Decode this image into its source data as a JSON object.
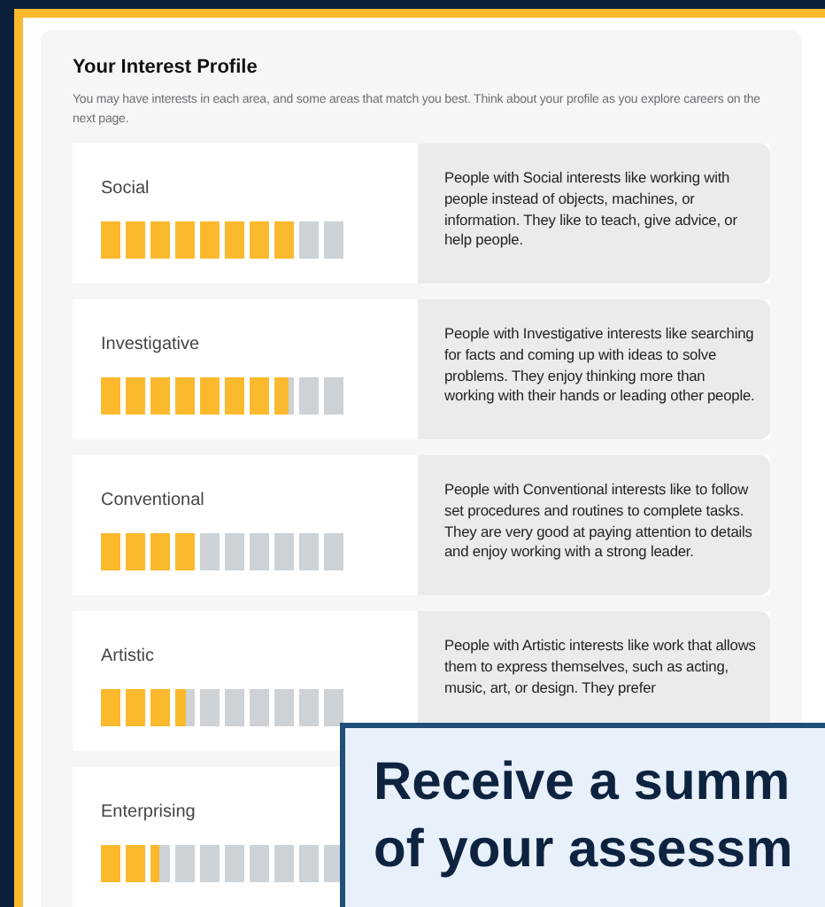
{
  "profile": {
    "title": "Your Interest Profile",
    "intro": "You may have interests in each area, and some areas that match you best. Think about your profile as you explore careers on the next page."
  },
  "areas": [
    {
      "name": "Social",
      "level": 0.8,
      "description": "People with Social interests like working with people instead of objects, machines, or information. They like to teach, give advice, or help people."
    },
    {
      "name": "Investigative",
      "level": 0.775,
      "description": "People with Investigative interests like searching for facts and coming up with ideas to solve problems. They enjoy thinking more than working with their hands or leading other people."
    },
    {
      "name": "Conventional",
      "level": 0.4,
      "description": "People with Conventional interests like to follow set procedures and routines to complete tasks. They are very good at paying attention to details and enjoy working with a strong leader."
    },
    {
      "name": "Artistic",
      "level": 0.35,
      "description": "People with Artistic interests like work that allows them to express themselves, such as acting, music, art, or design. They prefer"
    },
    {
      "name": "Enterprising",
      "level": 0.24
    }
  ],
  "callout": {
    "lines": [
      "Receive a summ",
      "of your assessm"
    ]
  }
}
